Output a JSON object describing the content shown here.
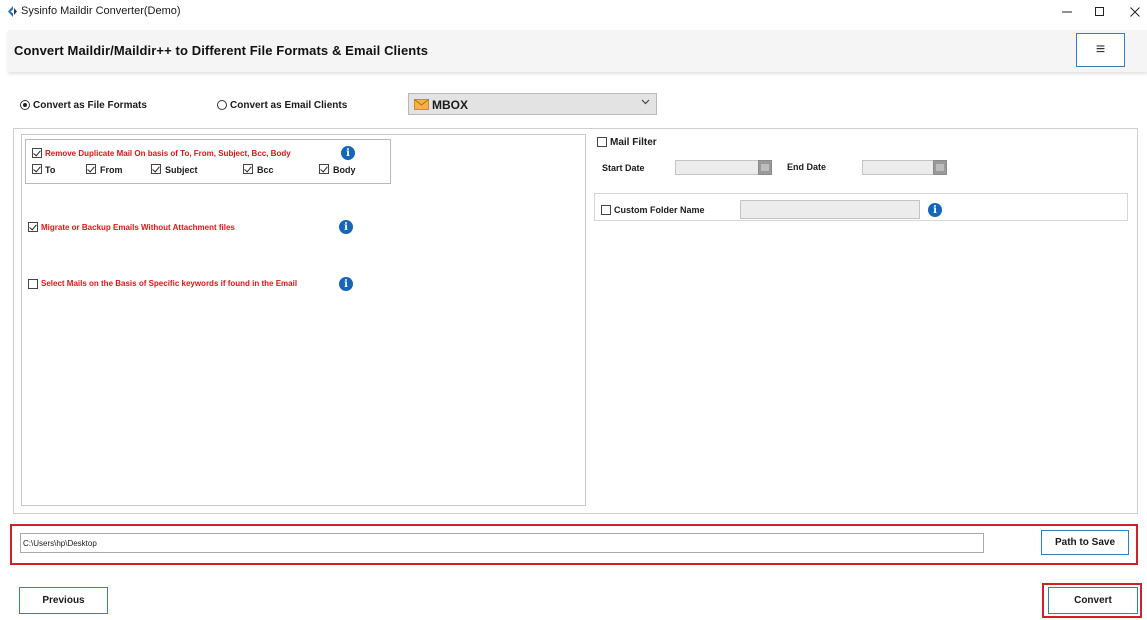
{
  "window": {
    "title": "Sysinfo Maildir Converter(Demo)",
    "minimize_icon": "minimize-icon",
    "maximize_icon": "maximize-icon",
    "close_icon": "close-icon"
  },
  "header": {
    "title": "Convert Maildir/Maildir++ to Different File Formats & Email Clients",
    "menu_icon": "hamburger-menu-icon",
    "menu_glyph": "≡"
  },
  "mode": {
    "file_formats_label": "Convert as File Formats",
    "email_clients_label": "Convert as Email Clients",
    "selected": "file_formats"
  },
  "format_select": {
    "value": "MBOX",
    "icon": "mbox-envelope-icon"
  },
  "options": {
    "duplicate": {
      "label": "Remove Duplicate Mail On basis of To, From, Subject, Bcc, Body",
      "checked": true,
      "fields": [
        {
          "label": "To",
          "checked": true
        },
        {
          "label": "From",
          "checked": true
        },
        {
          "label": "Subject",
          "checked": true
        },
        {
          "label": "Bcc",
          "checked": true
        },
        {
          "label": "Body",
          "checked": true
        }
      ]
    },
    "no_attachments": {
      "label": "Migrate or Backup Emails Without Attachment files",
      "checked": true
    },
    "keywords": {
      "label": "Select Mails on the Basis of Specific keywords if found in the Email",
      "checked": false
    },
    "info_glyph": "i"
  },
  "filter": {
    "mail_filter_label": "Mail Filter",
    "mail_filter_checked": false,
    "start_date_label": "Start Date",
    "end_date_label": "End Date",
    "start_date_value": "",
    "end_date_value": "",
    "custom_folder_label": "Custom Folder Name",
    "custom_folder_checked": false,
    "custom_folder_value": ""
  },
  "save": {
    "path": "C:\\Users\\hp\\Desktop",
    "path_button": "Path to Save"
  },
  "nav": {
    "previous": "Previous",
    "convert": "Convert"
  },
  "colors": {
    "accent_border": "#2f7ec7",
    "highlight_red": "#d0202a",
    "option_text_red": "#e01515",
    "info_blue": "#1565b9"
  }
}
